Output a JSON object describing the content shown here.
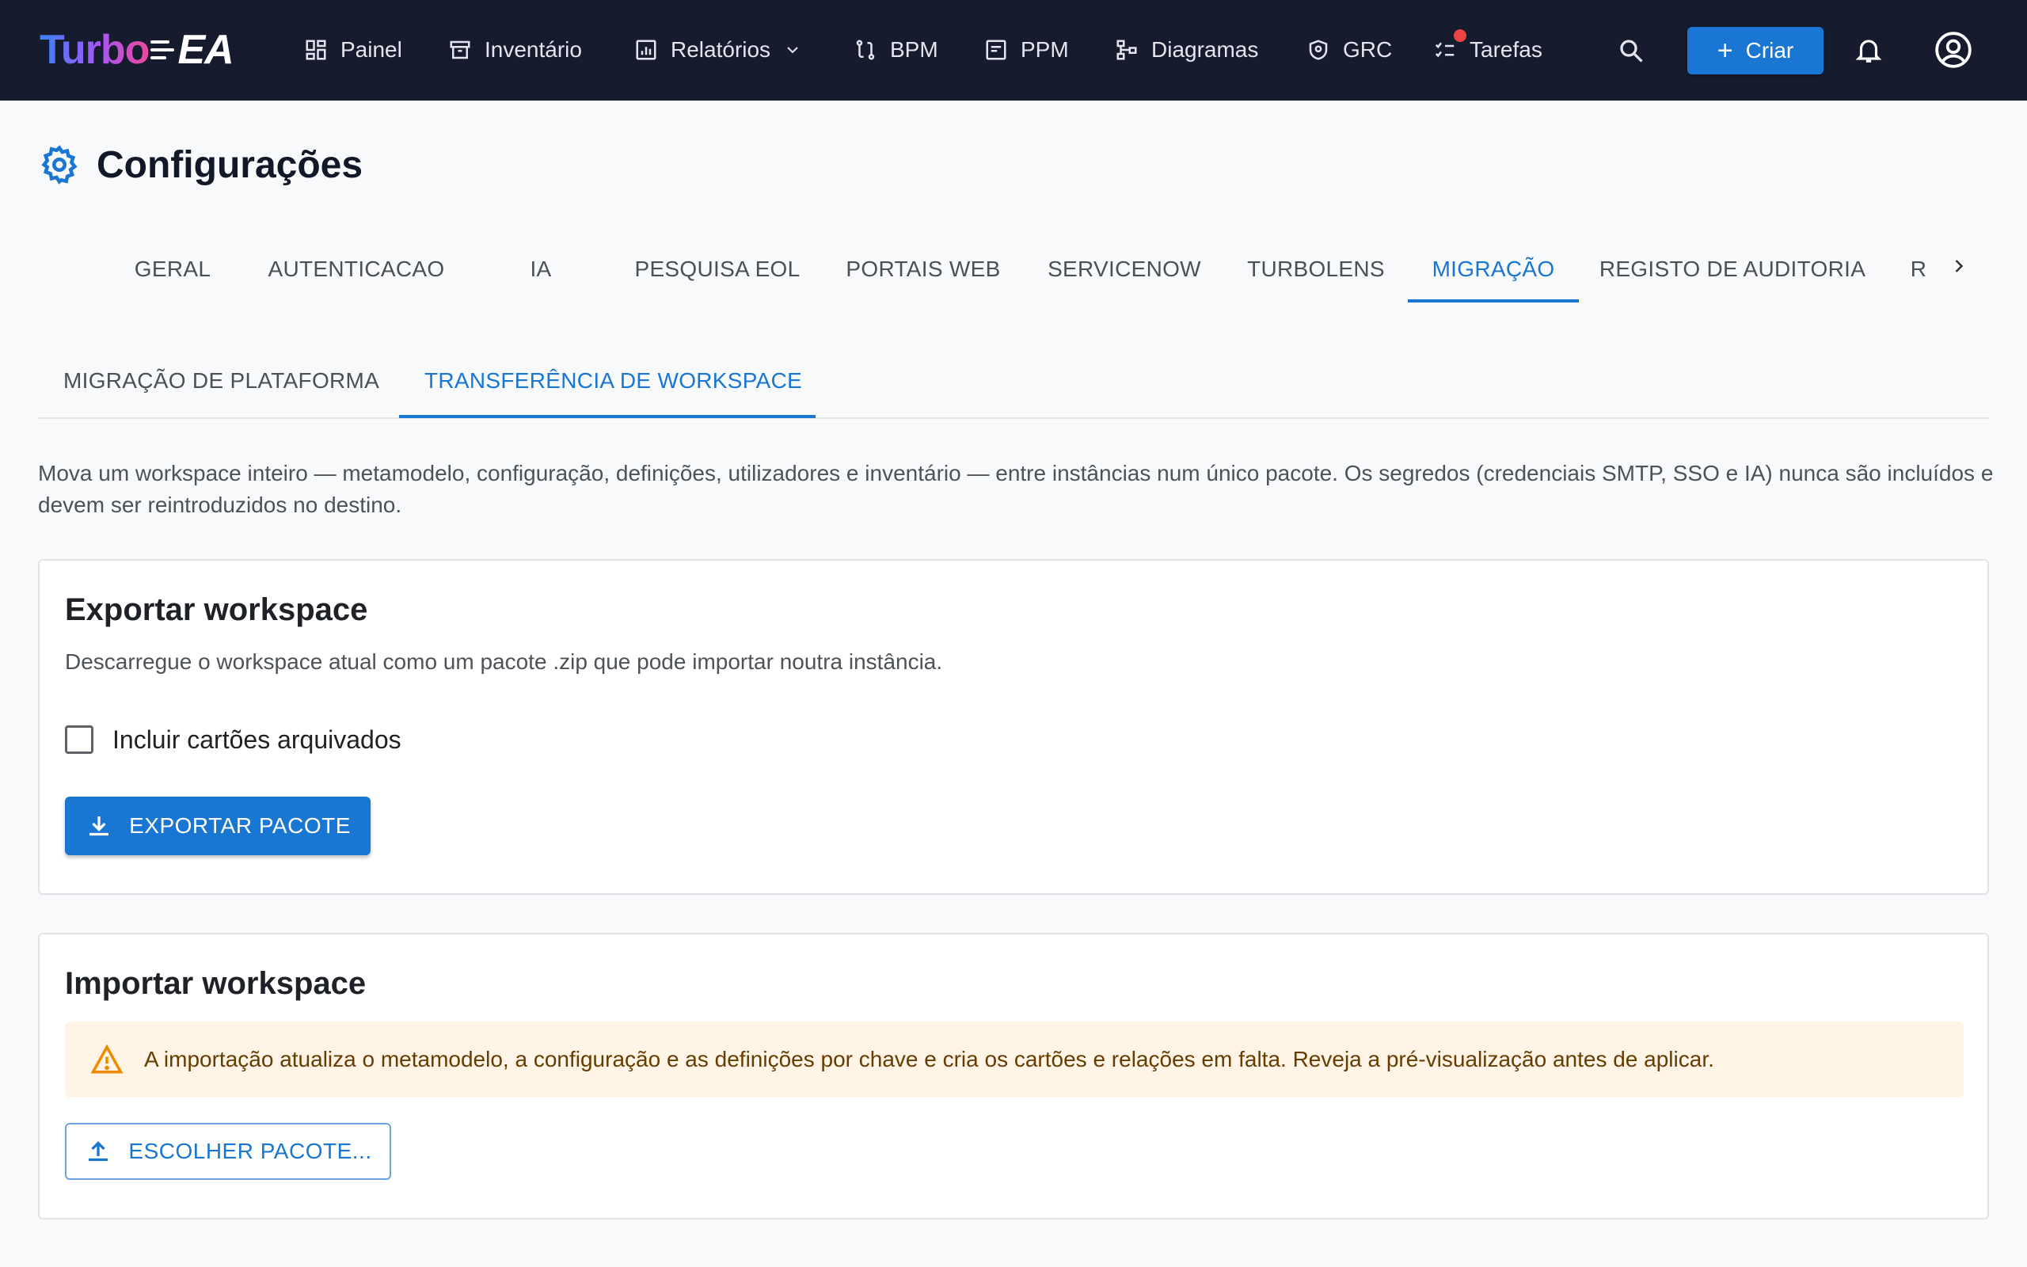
{
  "brand": {
    "part1": "Turbo",
    "part2": "EA"
  },
  "nav": {
    "items": [
      {
        "label": "Painel",
        "icon": "dashboard-icon"
      },
      {
        "label": "Inventário",
        "icon": "archive-icon"
      },
      {
        "label": "Relatórios",
        "icon": "report-icon"
      },
      {
        "label": "BPM",
        "icon": "process-icon"
      },
      {
        "label": "PPM",
        "icon": "project-icon"
      },
      {
        "label": "Diagramas",
        "icon": "diagram-icon"
      },
      {
        "label": "GRC",
        "icon": "shield-icon"
      },
      {
        "label": "Tarefas",
        "icon": "checklist-icon"
      }
    ],
    "create_label": "Criar"
  },
  "page": {
    "title": "Configurações"
  },
  "tabs": [
    "GERAL",
    "AUTENTICACAO",
    "IA",
    "PESQUISA EOL",
    "PORTAIS WEB",
    "SERVICENOW",
    "TURBOLENS",
    "MIGRAÇÃO",
    "REGISTO DE AUDITORIA",
    "R"
  ],
  "active_tab": "MIGRAÇÃO",
  "subtabs": [
    "MIGRAÇÃO DE PLATAFORMA",
    "TRANSFERÊNCIA DE WORKSPACE"
  ],
  "active_subtab": "TRANSFERÊNCIA DE WORKSPACE",
  "intro": "Mova um workspace inteiro — metamodelo, configuração, definições, utilizadores e inventário — entre instâncias num único pacote. Os segredos (credenciais SMTP, SSO e IA) nunca são incluídos e devem ser reintroduzidos no destino.",
  "export": {
    "title": "Exportar workspace",
    "description": "Descarregue o workspace atual como um pacote .zip que pode importar noutra instância.",
    "checkbox_label": "Incluir cartões arquivados",
    "checkbox_checked": false,
    "button_label": "EXPORTAR PACOTE"
  },
  "import": {
    "title": "Importar workspace",
    "alert": "A importação atualiza o metamodelo, a configuração e as definições por chave e cria os cartões e relações em falta. Reveja a pré-visualização antes de aplicar.",
    "button_label": "ESCOLHER PACOTE..."
  },
  "colors": {
    "topbar": "#171b2e",
    "accent": "#1976d2",
    "alert_bg": "#fff4e5",
    "alert_icon": "#ed8b00",
    "notification_dot": "#ef4444"
  }
}
